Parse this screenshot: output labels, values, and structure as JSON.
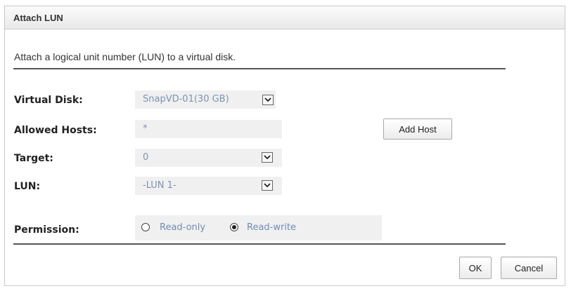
{
  "dialog": {
    "title": "Attach LUN",
    "description": "Attach a logical unit number (LUN) to a virtual disk."
  },
  "form": {
    "virtual_disk": {
      "label": "Virtual Disk:",
      "value": "SnapVD-01(30 GB)"
    },
    "allowed_hosts": {
      "label": "Allowed Hosts:",
      "value": "*"
    },
    "add_host_label": "Add Host",
    "target": {
      "label": "Target:",
      "value": "0"
    },
    "lun": {
      "label": "LUN:",
      "value": "-LUN 1-"
    },
    "permission": {
      "label": "Permission:",
      "options": [
        "Read-only",
        "Read-write"
      ],
      "selected": "Read-write"
    }
  },
  "buttons": {
    "ok": "OK",
    "cancel": "Cancel"
  }
}
